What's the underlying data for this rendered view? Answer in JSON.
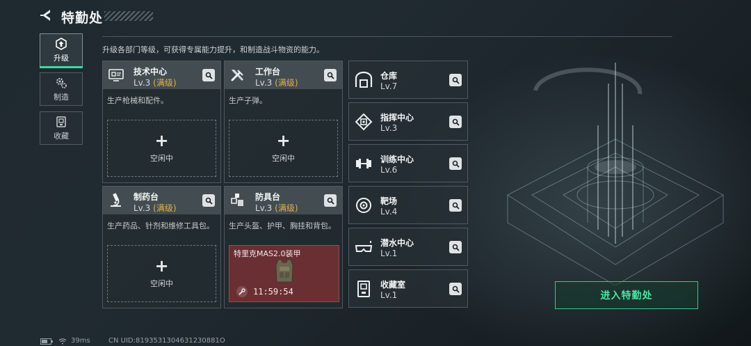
{
  "header": {
    "title": "特勤处"
  },
  "tabs": [
    {
      "label": "升级",
      "icon": "upgrade-icon",
      "active": true
    },
    {
      "label": "制造",
      "icon": "gears-icon",
      "active": false
    },
    {
      "label": "收藏",
      "icon": "collection-icon",
      "active": false
    }
  ],
  "subtitle": "升级各部门等级，可获得专属能力提升，和制造战斗物资的能力。",
  "workshops": [
    {
      "name": "技术中心",
      "level": "Lv.3",
      "max_tag": "(满级)",
      "desc": "生产枪械和配件。",
      "icon": "tech-center-icon",
      "slot": {
        "idle_label": "空闲中"
      }
    },
    {
      "name": "工作台",
      "level": "Lv.3",
      "max_tag": "(满级)",
      "desc": "生产子弹。",
      "icon": "workbench-icon",
      "slot": {
        "idle_label": "空闲中"
      }
    },
    {
      "name": "制药台",
      "level": "Lv.3",
      "max_tag": "(满级)",
      "desc": "生产药品、针剂和维修工具包。",
      "icon": "microscope-icon",
      "slot": {
        "idle_label": "空闲中"
      }
    },
    {
      "name": "防具台",
      "level": "Lv.3",
      "max_tag": "(满级)",
      "desc": "生产头盔、护甲、胸挂和背包。",
      "icon": "armor-bench-icon",
      "slot": {
        "item_name": "特里克MAS2.0装甲",
        "timer": "11:59:54",
        "color": "#6a2f33"
      }
    }
  ],
  "facilities": [
    {
      "name": "仓库",
      "level": "Lv.7",
      "icon": "warehouse-icon"
    },
    {
      "name": "指挥中心",
      "level": "Lv.3",
      "icon": "chip-icon"
    },
    {
      "name": "训练中心",
      "level": "Lv.6",
      "icon": "dumbbell-icon"
    },
    {
      "name": "靶场",
      "level": "Lv.4",
      "icon": "target-icon"
    },
    {
      "name": "潜水中心",
      "level": "Lv.1",
      "icon": "diving-mask-icon"
    },
    {
      "name": "收藏室",
      "level": "Lv.1",
      "icon": "collection-room-icon"
    }
  ],
  "enter_button": {
    "label": "进入特勤处",
    "color": "#4ee3a3"
  },
  "status": {
    "ping": "39ms",
    "uid": "CN UID:8193531304631230881O"
  },
  "colors": {
    "accent": "#3fd9a0",
    "max_level": "#e3b04a"
  }
}
